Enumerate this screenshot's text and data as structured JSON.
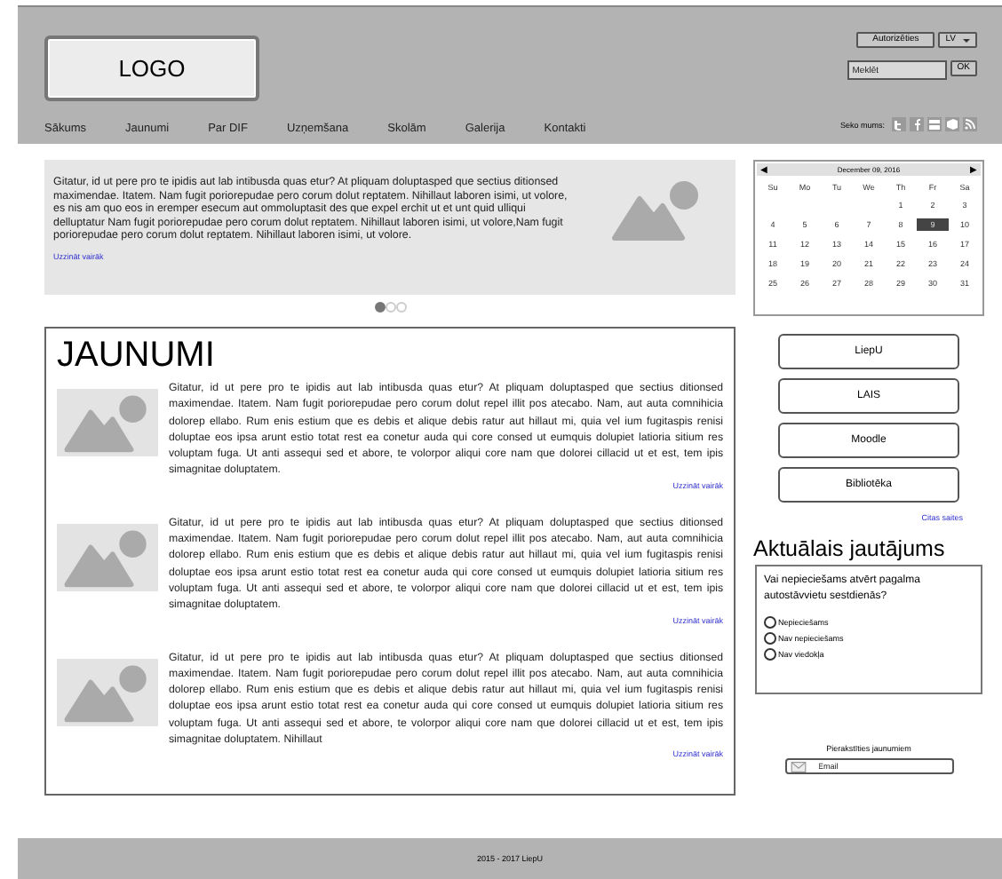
{
  "header": {
    "logo": "LOGO",
    "login_button": "Autorizēties",
    "language": "LV",
    "search": {
      "placeholder": "Meklēt",
      "button": "OK"
    },
    "follow_label": "Seko mums:"
  },
  "nav": [
    {
      "label": "Sākums"
    },
    {
      "label": "Jaunumi"
    },
    {
      "label": "Par DIF"
    },
    {
      "label": "Uzņemšana"
    },
    {
      "label": "Skolām"
    },
    {
      "label": "Galerija"
    },
    {
      "label": "Kontakti"
    }
  ],
  "slider": {
    "text": "Gitatur, id ut pere pro te ipidis aut lab intibusda quas etur? At pliquam doluptasped que sectius ditionsed maximendae. Itatem. Nam fugit poriorepudae pero corum dolut reptatem. Nihillaut laboren isimi, ut volore, es nis am quo eos in eremper esecum aut ommoluptasit des que expel erchit ut et unt quid ulliqui delluptatur Nam fugit poriorepudae pero corum dolut reptatem. Nihillaut laboren isimi, ut volore,Nam fugit poriorepudae pero corum dolut reptatem. Nihillaut laboren isimi, ut volore.",
    "link": "Uzzināt vairāk",
    "dots": [
      {
        "selected": true
      },
      {
        "selected": false
      },
      {
        "selected": false
      }
    ]
  },
  "calendar": {
    "prev": "◀",
    "title": "December 09, 2016",
    "next": "▶",
    "weekdays": [
      "Su",
      "Mo",
      "Tu",
      "We",
      "Th",
      "Fr",
      "Sa"
    ],
    "weeks": [
      [
        {
          "day": "1",
          "selected": false
        },
        {
          "day": "2",
          "selected": false
        },
        {
          "day": "3",
          "selected": false
        }
      ],
      [
        {
          "day": "4",
          "selected": false
        },
        {
          "day": "5",
          "selected": false
        },
        {
          "day": "6",
          "selected": false
        },
        {
          "day": "7",
          "selected": false
        },
        {
          "day": "8",
          "selected": false
        },
        {
          "day": "9",
          "selected": true
        },
        {
          "day": "10",
          "selected": false
        }
      ],
      [
        {
          "day": "11",
          "selected": false
        },
        {
          "day": "12",
          "selected": false
        },
        {
          "day": "13",
          "selected": false
        },
        {
          "day": "14",
          "selected": false
        },
        {
          "day": "15",
          "selected": false
        },
        {
          "day": "16",
          "selected": false
        },
        {
          "day": "17",
          "selected": false
        }
      ],
      [
        {
          "day": "18",
          "selected": false
        },
        {
          "day": "19",
          "selected": false
        },
        {
          "day": "20",
          "selected": false
        },
        {
          "day": "21",
          "selected": false
        },
        {
          "day": "22",
          "selected": false
        },
        {
          "day": "23",
          "selected": false
        },
        {
          "day": "24",
          "selected": false
        }
      ],
      [
        {
          "day": "25",
          "selected": false
        },
        {
          "day": "26",
          "selected": false
        },
        {
          "day": "27",
          "selected": false
        },
        {
          "day": "28",
          "selected": false
        },
        {
          "day": "29",
          "selected": false
        },
        {
          "day": "30",
          "selected": false
        },
        {
          "day": "31",
          "selected": false
        }
      ]
    ]
  },
  "news": {
    "title": "JAUNUMI",
    "articles": [
      {
        "text": "Gitatur, id ut pere pro te ipidis aut lab intibusda quas etur? At pliquam doluptasped que sectius ditionsed maximendae. Itatem. Nam fugit poriorepudae pero corum dolut repel illit pos atecabo. Nam, aut auta comnihicia dolorep ellabo. Rum enis estium que es debis et alique debis ratur aut hillaut mi, quia vel ium fugitaspis renisi doluptae eos ipsa arunt estio totat rest ea conetur auda qui core consed ut eumquis dolupiet latioria sitium res voluptam fuga. Ut anti assequi sed et abore, te volorpor aliqui core nam que dolorei cillacid ut et est, tem ipis simagnitae doluptatem.",
        "link": "Uzzināt vairāk"
      },
      {
        "text": "Gitatur, id ut pere pro te ipidis aut lab intibusda quas etur? At pliquam doluptasped que sectius ditionsed maximendae. Itatem. Nam fugit poriorepudae pero corum dolut repel illit pos atecabo. Nam, aut auta comnihicia dolorep ellabo. Rum enis estium que es debis et alique debis ratur aut hillaut mi, quia vel ium fugitaspis renisi doluptae eos ipsa arunt estio totat rest ea conetur auda qui core consed ut eumquis dolupiet latioria sitium res voluptam fuga. Ut anti assequi sed et abore, te volorpor aliqui core nam que dolorei cillacid ut et est, tem ipis simagnitae doluptatem.",
        "link": "Uzzināt vairāk"
      },
      {
        "text": "Gitatur, id ut pere pro te ipidis aut lab intibusda quas etur? At pliquam doluptasped que sectius ditionsed maximendae. Itatem. Nam fugit poriorepudae pero corum dolut repel illit pos atecabo. Nam, aut auta comnihicia dolorep ellabo. Rum enis estium que es debis et alique debis ratur aut hillaut mi, quia vel ium fugitaspis renisi doluptae eos ipsa arunt estio totat rest ea conetur auda qui core consed ut eumquis dolupiet latioria sitium res voluptam fuga. Ut anti assequi sed et abore, te volorpor aliqui core nam que dolorei cillacid ut et est, tem ipis simagnitae doluptatem. Nihillaut",
        "link": "Uzzināt vairāk"
      }
    ]
  },
  "links": [
    {
      "label": "LiepU"
    },
    {
      "label": "LAIS"
    },
    {
      "label": "Moodle"
    },
    {
      "label": "Bibliotēka"
    }
  ],
  "more_links": "Citas saites",
  "poll": {
    "title": "Aktuālais jautājums",
    "question": "Vai nepieciešams atvērt pagalma autostāvvietu sestdienās?",
    "options": [
      {
        "label": "Nepieciešams",
        "selected": false
      },
      {
        "label": "Nav nepieciešams",
        "selected": false
      },
      {
        "label": "Nav viedokļa",
        "selected": false
      }
    ]
  },
  "newsletter": {
    "label": "Pierakstīties jaunumiem",
    "placeholder": "Email"
  },
  "footer": "2015 - 2017 LiepU"
}
